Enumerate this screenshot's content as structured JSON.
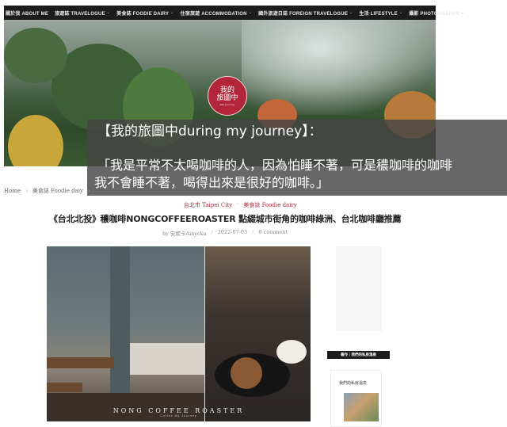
{
  "nav": {
    "items": [
      {
        "label": "關於我 ABOUT ME",
        "has_dropdown": false
      },
      {
        "label": "旅遊誌 TRAVELOGUE",
        "has_dropdown": true
      },
      {
        "label": "美食誌 FOODIE DAIRY",
        "has_dropdown": true
      },
      {
        "label": "住宿旅遊 ACCOMMODATION",
        "has_dropdown": true
      },
      {
        "label": "國外旅遊日誌 FOREIGN TRAVELOGUE",
        "has_dropdown": true
      },
      {
        "label": "生活 LIFESTYLE",
        "has_dropdown": true
      },
      {
        "label": "攝影 PHOTOGRAPHY",
        "has_dropdown": true
      }
    ],
    "chevron_icon": "chevron-down-icon"
  },
  "logo": {
    "line1": "我的",
    "line2": "旅圖中",
    "line3": "kaa journey"
  },
  "overlay": {
    "line1": "【我的旅圖中during my journey】：",
    "line2": "「我是平常不太喝咖啡的人，因為怕睡不著，可是穠咖啡的咖啡",
    "line3": "我不會睡不著，喝得出來是很好的咖啡。」"
  },
  "breadcrumb": {
    "home": "Home",
    "category": "美食誌 Foodie daiy"
  },
  "post": {
    "categories": [
      "台北市 Taipei City",
      "美食誌 Foodie dairy"
    ],
    "title": "《台北北投》穠咖啡NONGCOFFEEROASTER 點綴城市街角的咖啡綠洲、台北咖啡廳推薦",
    "author": "by 安妮卡Ainycka",
    "date": "2022-07-03",
    "comments": "0 comment"
  },
  "photo": {
    "caption": "NONG COFFEE ROASTER",
    "subcaption": "Coffee  My  Journey"
  },
  "sidebar": {
    "heading": "著作｜我們的私房溫泉",
    "book_title": "我們的私房溫泉"
  }
}
